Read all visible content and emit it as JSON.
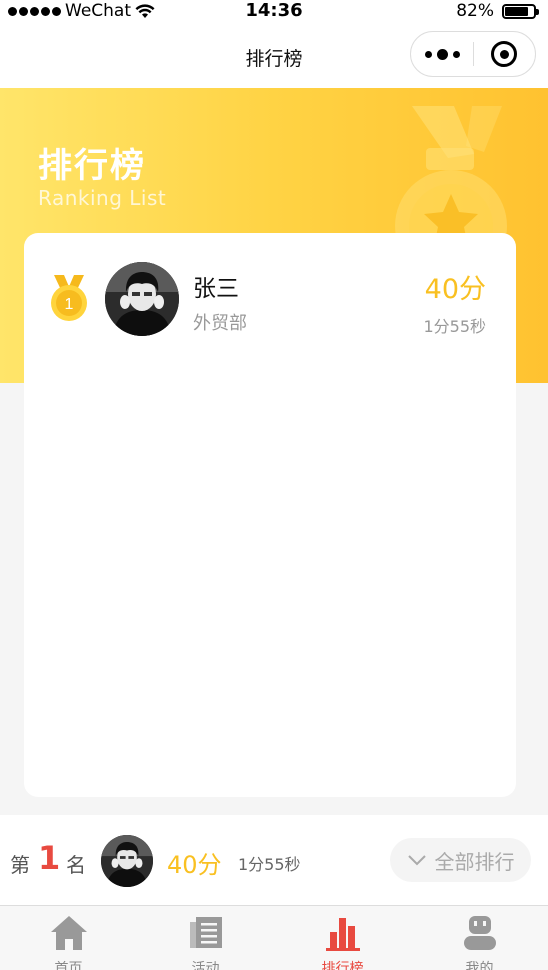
{
  "status_bar": {
    "carrier": "WeChat",
    "time": "14:36",
    "battery": "82%",
    "battery_level": 0.82
  },
  "nav": {
    "title": "排行榜"
  },
  "banner": {
    "title": "排行榜",
    "subtitle": "Ranking List"
  },
  "ranking": [
    {
      "rank": "1",
      "name": "张三",
      "department": "外贸部",
      "score": "40分",
      "time": "1分55秒"
    }
  ],
  "my_rank": {
    "prefix": "第",
    "rank": "1",
    "suffix": "名",
    "score": "40分",
    "time": "1分55秒",
    "all_button": "全部排行"
  },
  "tabs": [
    {
      "label": "首页",
      "icon": "home-icon"
    },
    {
      "label": "活动",
      "icon": "document-icon"
    },
    {
      "label": "排行榜",
      "icon": "bar-chart-icon",
      "active": true
    },
    {
      "label": "我的",
      "icon": "robot-user-icon"
    }
  ],
  "colors": {
    "accent": "#e84a40",
    "gold": "#f9c021",
    "banner_start": "#ffe56a",
    "banner_end": "#ffc230"
  }
}
